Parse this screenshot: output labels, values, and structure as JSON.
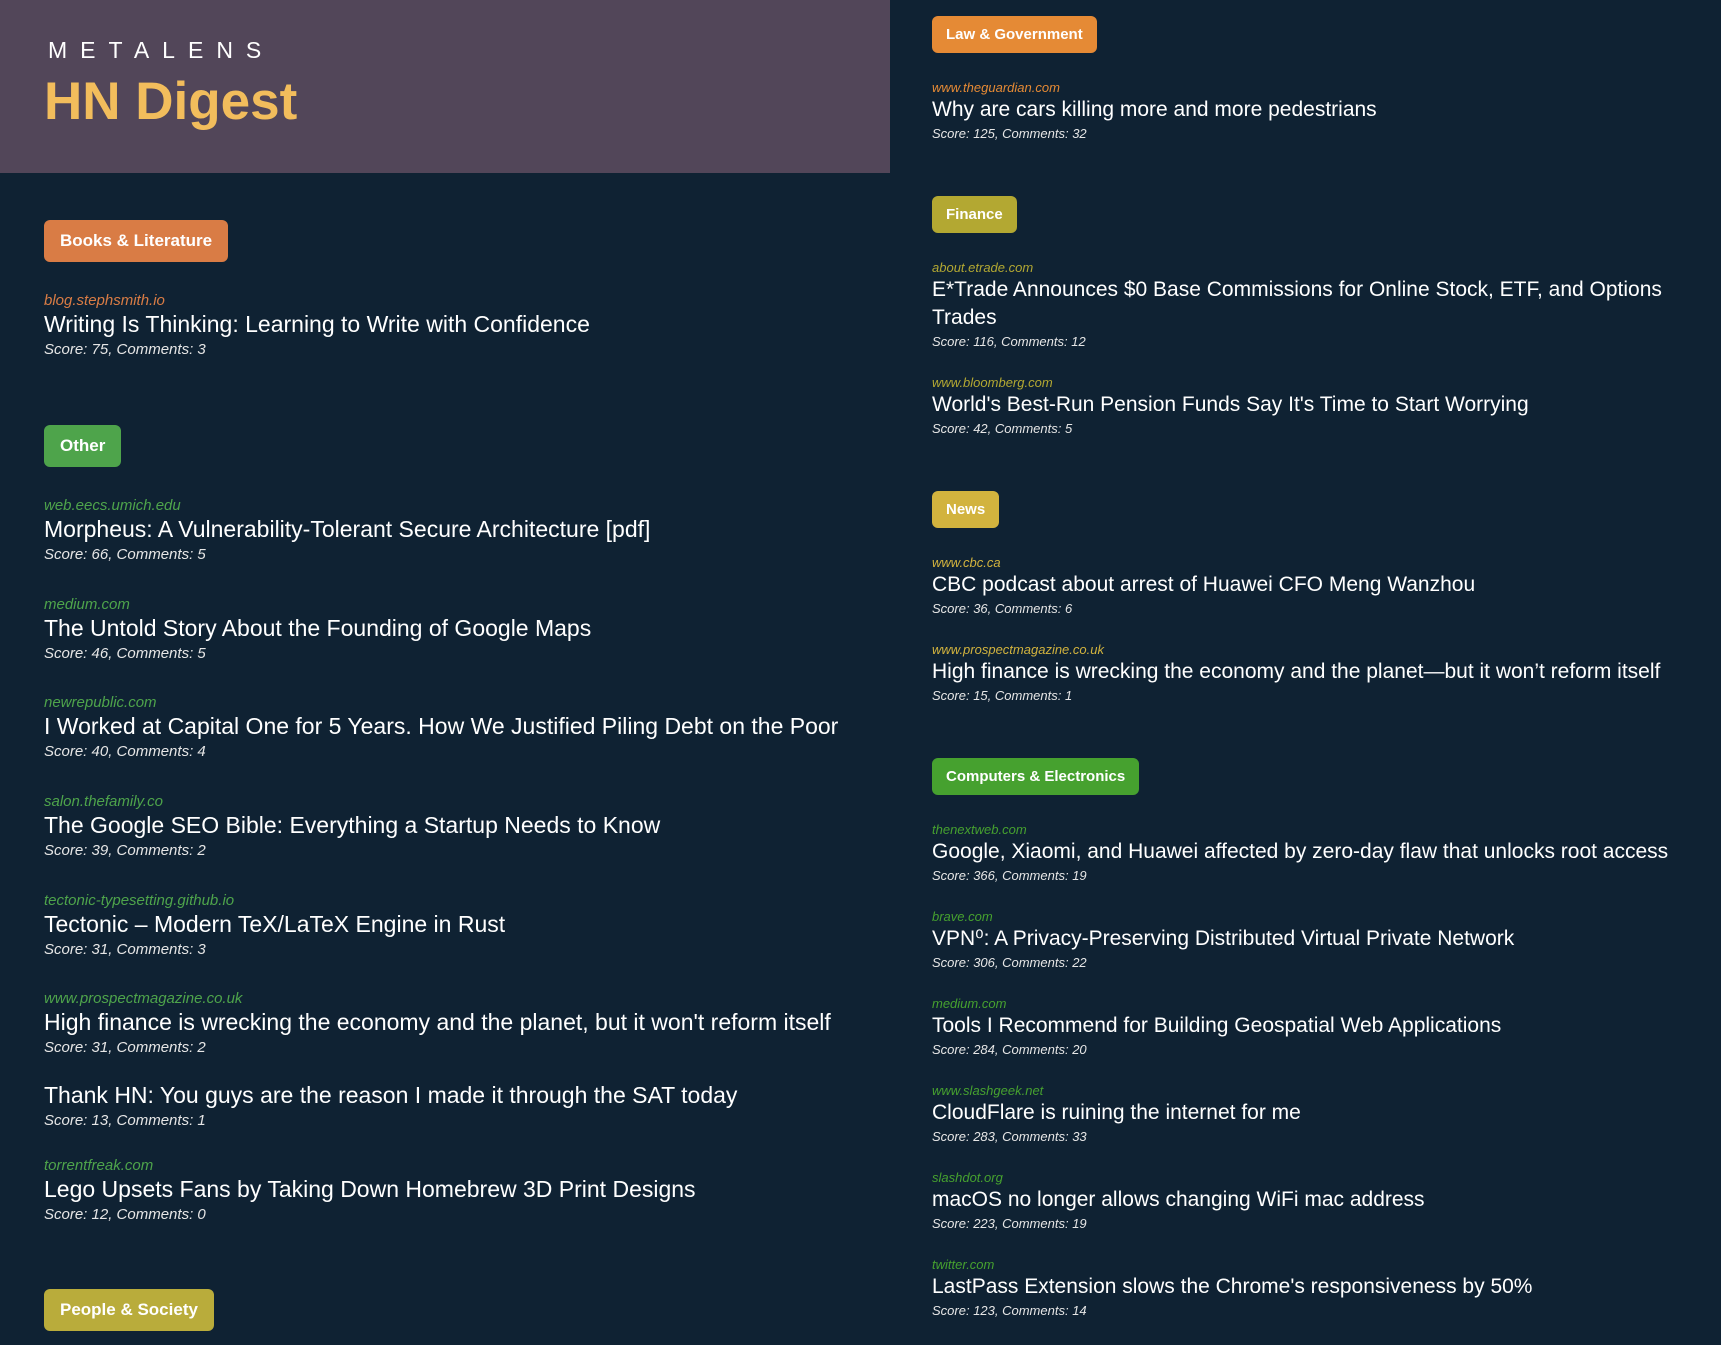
{
  "header": {
    "brand": "METALENS",
    "title": "HN Digest"
  },
  "labels": {
    "score": "Score: ",
    "comments": ", Comments: "
  },
  "colors": {
    "background": "#0f2233",
    "header_bg": "#524659",
    "title": "#f2bd5c"
  },
  "left": {
    "books": {
      "label": "Books & Literature",
      "color": "#d97c45",
      "domain_color": "#d97c45",
      "stories": [
        {
          "domain": "blog.stephsmith.io",
          "title": "Writing Is Thinking: Learning to Write with Confidence",
          "score": "75",
          "comments": "3"
        }
      ]
    },
    "other": {
      "label": "Other",
      "color": "#4ea44b",
      "domain_color": "#4ea44b",
      "stories": [
        {
          "domain": "web.eecs.umich.edu",
          "title": "Morpheus: A Vulnerability-Tolerant Secure Architecture [pdf]",
          "score": "66",
          "comments": "5"
        },
        {
          "domain": "medium.com",
          "title": "The Untold Story About the Founding of Google Maps",
          "score": "46",
          "comments": "5"
        },
        {
          "domain": "newrepublic.com",
          "title": "I Worked at Capital One for 5 Years. How We Justified Piling Debt on the Poor",
          "score": "40",
          "comments": "4"
        },
        {
          "domain": "salon.thefamily.co",
          "title": "The Google SEO Bible: Everything a Startup Needs to Know",
          "score": "39",
          "comments": "2"
        },
        {
          "domain": "tectonic-typesetting.github.io",
          "title": "Tectonic – Modern TeX/LaTeX Engine in Rust",
          "score": "31",
          "comments": "3"
        },
        {
          "domain": "www.prospectmagazine.co.uk",
          "title": "High finance is wrecking the economy and the planet, but it won't reform itself",
          "score": "31",
          "comments": "2"
        },
        {
          "domain": "",
          "title": "Thank HN: You guys are the reason I made it through the SAT today",
          "score": "13",
          "comments": "1"
        },
        {
          "domain": "torrentfreak.com",
          "title": "Lego Upsets Fans by Taking Down Homebrew 3D Print Designs",
          "score": "12",
          "comments": "0"
        }
      ]
    },
    "people": {
      "label": "People & Society",
      "color": "#b9ac3b"
    }
  },
  "right": {
    "law": {
      "label": "Law & Government",
      "color": "#e58a35",
      "domain_color": "#e58a35",
      "stories": [
        {
          "domain": "www.theguardian.com",
          "title": "Why are cars killing more and more pedestrians",
          "score": "125",
          "comments": "32"
        }
      ]
    },
    "finance": {
      "label": "Finance",
      "color": "#b3a832",
      "domain_color": "#b3a832",
      "stories": [
        {
          "domain": "about.etrade.com",
          "title": "E*Trade Announces $0 Base Commissions for Online Stock, ETF, and Options Trades",
          "score": "116",
          "comments": "12"
        },
        {
          "domain": "www.bloomberg.com",
          "title": "World's Best-Run Pension Funds Say It's Time to Start Worrying",
          "score": "42",
          "comments": "5"
        }
      ]
    },
    "news": {
      "label": "News",
      "color": "#d2b33e",
      "domain_color": "#d2b33e",
      "stories": [
        {
          "domain": "www.cbc.ca",
          "title": "CBC podcast about arrest of Huawei CFO Meng Wanzhou",
          "score": "36",
          "comments": "6"
        },
        {
          "domain": "www.prospectmagazine.co.uk",
          "title": "High finance is wrecking the economy and the planet—but it won’t reform itself",
          "score": "15",
          "comments": "1"
        }
      ]
    },
    "computers": {
      "label": "Computers & Electronics",
      "color": "#46a12f",
      "domain_color": "#46a12f",
      "stories": [
        {
          "domain": "thenextweb.com",
          "title": "Google, Xiaomi, and Huawei affected by zero-day flaw that unlocks root access",
          "score": "366",
          "comments": "19"
        },
        {
          "domain": "brave.com",
          "title": "VPN⁰: A Privacy-Preserving Distributed Virtual Private Network",
          "score": "306",
          "comments": "22"
        },
        {
          "domain": "medium.com",
          "title": "Tools I Recommend for Building Geospatial Web Applications",
          "score": "284",
          "comments": "20"
        },
        {
          "domain": "www.slashgeek.net",
          "title": "CloudFlare is ruining the internet for me",
          "score": "283",
          "comments": "33"
        },
        {
          "domain": "slashdot.org",
          "title": "macOS no longer allows changing WiFi mac address",
          "score": "223",
          "comments": "19"
        },
        {
          "domain": "twitter.com",
          "title": "LastPass Extension slows the Chrome's responsiveness by 50%",
          "score": "123",
          "comments": "14"
        }
      ]
    }
  }
}
